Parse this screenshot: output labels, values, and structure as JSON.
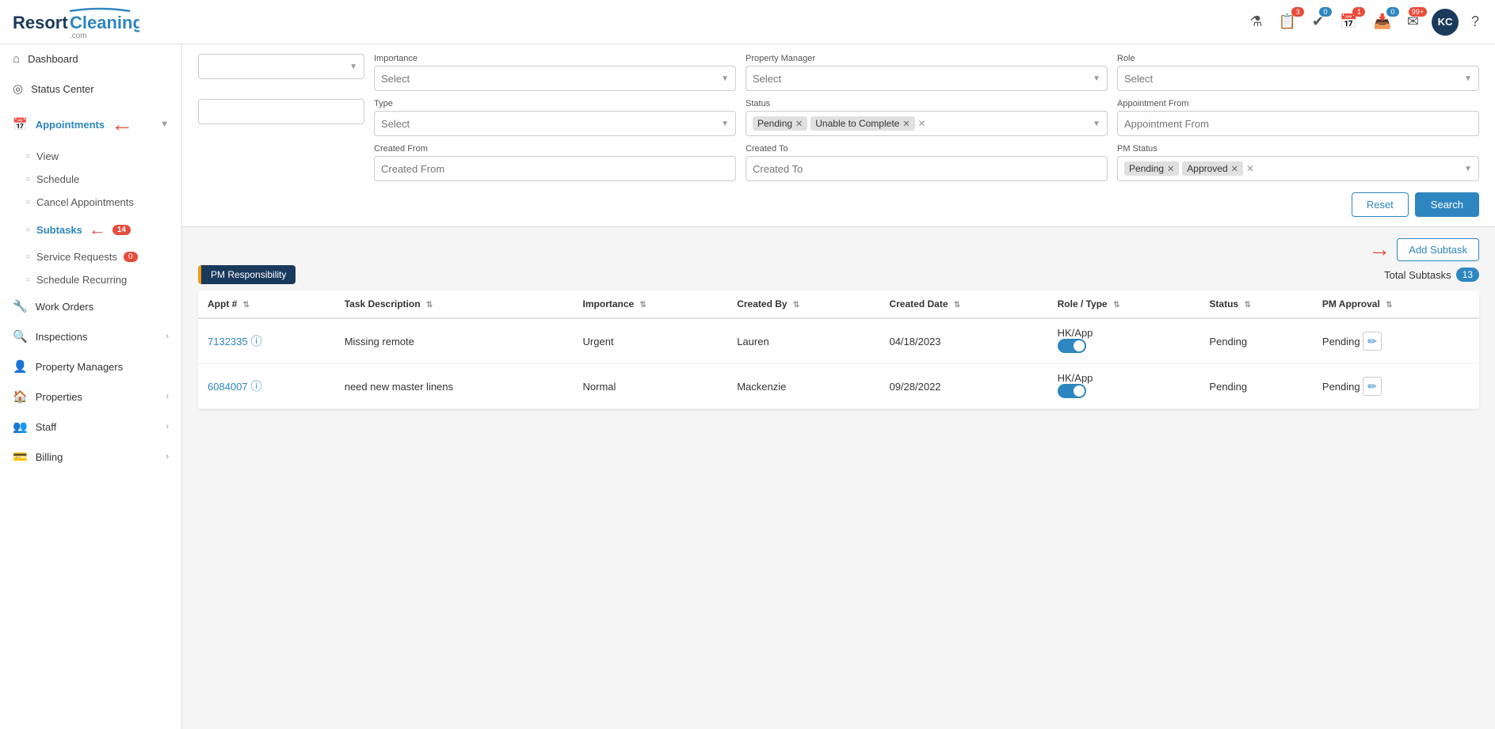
{
  "header": {
    "logo_main": "Resort",
    "logo_accent": "Cleaning",
    "logo_sub": ".com",
    "icons": [
      {
        "name": "filter-icon",
        "symbol": "⚗",
        "badge": null
      },
      {
        "name": "clipboard-icon",
        "symbol": "📋",
        "badge": "3",
        "badge_type": "red"
      },
      {
        "name": "check-icon",
        "symbol": "✓",
        "badge": "0",
        "badge_type": "blue"
      },
      {
        "name": "calendar-icon",
        "symbol": "📅",
        "badge": "1",
        "badge_type": "red"
      },
      {
        "name": "inbox-icon",
        "symbol": "📥",
        "badge": "0",
        "badge_type": "blue"
      },
      {
        "name": "mail-icon",
        "symbol": "✉",
        "badge": "99+",
        "badge_type": "red"
      }
    ],
    "avatar_initials": "KC",
    "help_symbol": "?"
  },
  "sidebar": {
    "items": [
      {
        "id": "dashboard",
        "label": "Dashboard",
        "icon": "⌂",
        "has_chevron": false,
        "badge": null
      },
      {
        "id": "status-center",
        "label": "Status Center",
        "icon": "◎",
        "has_chevron": false,
        "badge": null
      },
      {
        "id": "appointments",
        "label": "Appointments",
        "icon": "📅",
        "has_chevron": true,
        "badge": null,
        "active": true,
        "sub_items": [
          {
            "id": "view",
            "label": "View",
            "badge": null
          },
          {
            "id": "schedule",
            "label": "Schedule",
            "badge": null
          },
          {
            "id": "cancel-appointments",
            "label": "Cancel Appointments",
            "badge": null
          },
          {
            "id": "subtasks",
            "label": "Subtasks",
            "badge": "14",
            "active": true
          },
          {
            "id": "service-requests",
            "label": "Service Requests",
            "badge": "0"
          },
          {
            "id": "schedule-recurring",
            "label": "Schedule Recurring",
            "badge": null
          }
        ]
      },
      {
        "id": "work-orders",
        "label": "Work Orders",
        "icon": "🔧",
        "has_chevron": false,
        "badge": null
      },
      {
        "id": "inspections",
        "label": "Inspections",
        "icon": "🔍",
        "has_chevron": true,
        "badge": null
      },
      {
        "id": "property-managers",
        "label": "Property Managers",
        "icon": "👤",
        "has_chevron": false,
        "badge": null
      },
      {
        "id": "properties",
        "label": "Properties",
        "icon": "🏠",
        "has_chevron": true,
        "badge": null
      },
      {
        "id": "staff",
        "label": "Staff",
        "icon": "👥",
        "has_chevron": true,
        "badge": null
      },
      {
        "id": "billing",
        "label": "Billing",
        "icon": "💳",
        "has_chevron": true,
        "badge": null
      }
    ]
  },
  "filters": {
    "importance_label": "Importance",
    "importance_placeholder": "Select",
    "property_manager_label": "Property Manager",
    "property_manager_placeholder": "Select",
    "role_label": "Role",
    "role_placeholder": "Select",
    "type_label": "Type",
    "type_placeholder": "Select",
    "status_label": "Status",
    "status_tags": [
      {
        "label": "Pending"
      },
      {
        "label": "Unable to Complete"
      }
    ],
    "appointment_from_label": "Appointment From",
    "appointment_from_placeholder": "Appointment From",
    "created_from_label": "Created From",
    "created_from_placeholder": "Created From",
    "created_to_label": "Created To",
    "created_to_placeholder": "Created To",
    "pm_status_label": "PM Status",
    "pm_status_tags": [
      {
        "label": "Pending"
      },
      {
        "label": "Approved"
      }
    ],
    "reset_label": "Reset",
    "search_label": "Search"
  },
  "table": {
    "add_subtask_label": "Add Subtask",
    "pm_responsibility_label": "PM Responsibility",
    "total_subtasks_label": "Total Subtasks",
    "total_subtasks_count": "13",
    "columns": [
      {
        "id": "appt",
        "label": "Appt #"
      },
      {
        "id": "task",
        "label": "Task Description"
      },
      {
        "id": "importance",
        "label": "Importance"
      },
      {
        "id": "created_by",
        "label": "Created By"
      },
      {
        "id": "created_date",
        "label": "Created Date"
      },
      {
        "id": "role_type",
        "label": "Role / Type"
      },
      {
        "id": "status",
        "label": "Status"
      },
      {
        "id": "pm_approval",
        "label": "PM Approval"
      }
    ],
    "rows": [
      {
        "appt_num": "7132335",
        "task_desc": "Missing remote",
        "importance": "Urgent",
        "created_by": "Lauren",
        "created_date": "04/18/2023",
        "role_type": "HK/App",
        "toggle": true,
        "status": "Pending",
        "pm_approval": "Pending"
      },
      {
        "appt_num": "6084007",
        "task_desc": "need new master linens",
        "importance": "Normal",
        "created_by": "Mackenzie",
        "created_date": "09/28/2022",
        "role_type": "HK/App",
        "toggle": true,
        "status": "Pending",
        "pm_approval": "Pending"
      }
    ]
  }
}
